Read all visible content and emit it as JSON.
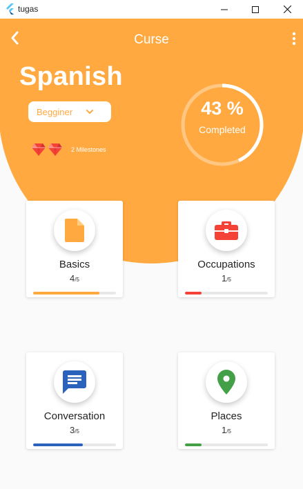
{
  "window": {
    "title": "tugas"
  },
  "header": {
    "title": "Curse"
  },
  "course": {
    "language": "Spanish",
    "level": "Begginer",
    "milestones_label": "2 Milestones",
    "progress": {
      "percent": 43,
      "percent_text": "43 %",
      "label": "Completed"
    }
  },
  "colors": {
    "accent": "#ffa940",
    "white": "#ffffff",
    "basics": "#ffa940",
    "occupations": "#f44336",
    "conversation": "#2a62bc",
    "places": "#43a047",
    "gem": "#f44336"
  },
  "cards": [
    {
      "title": "Basics",
      "done": "4",
      "total": "/5",
      "progress": 0.8,
      "icon": "document-icon"
    },
    {
      "title": "Occupations",
      "done": "1",
      "total": "/5",
      "progress": 0.2,
      "icon": "briefcase-icon"
    },
    {
      "title": "Conversation",
      "done": "3",
      "total": "/5",
      "progress": 0.6,
      "icon": "chat-icon"
    },
    {
      "title": "Places",
      "done": "1",
      "total": "/5",
      "progress": 0.2,
      "icon": "location-pin-icon"
    }
  ]
}
